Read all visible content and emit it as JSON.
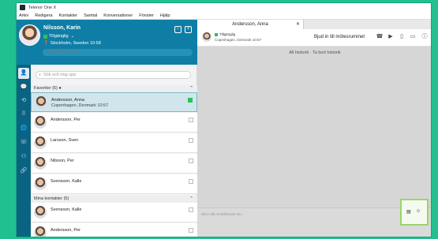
{
  "titlebar": {
    "title": "Telenor One X"
  },
  "menu": [
    "Arkiv",
    "Redigera",
    "Kontakter",
    "Samtal",
    "Konversationer",
    "Fönster",
    "Hjälp"
  ],
  "profile": {
    "name": "Nilsson, Karin",
    "status": "Tillgänglig",
    "location": "Stockholm, Sweden  10:58",
    "status_input_placeholder": "Vad händer idag?"
  },
  "search": {
    "placeholder": "Sök och ring upp"
  },
  "favorites": {
    "header": "Favoriter (5)",
    "items": [
      {
        "name": "Andersson, Anna",
        "location": "Copenhagen, Denmark 10:57",
        "status": "available",
        "selected": true
      },
      {
        "name": "Andersson, Per",
        "location": "",
        "status": "offline",
        "selected": false
      },
      {
        "name": "Larsson, Sven",
        "location": "",
        "status": "offline",
        "selected": false
      },
      {
        "name": "Nilsson, Per",
        "location": "",
        "status": "offline",
        "selected": false
      },
      {
        "name": "Svensson, Kalle",
        "location": "",
        "status": "offline",
        "selected": false
      }
    ]
  },
  "my_contacts": {
    "header": "Mina kontakter (5)",
    "items": [
      {
        "name": "Svensson, Kalle"
      },
      {
        "name": "Andersson, Per"
      }
    ]
  },
  "conversation": {
    "tab_label": "Andersson, Anna",
    "contact_status": "Tillgänglig",
    "contact_location": "Copenhagen, Denmark 10:57",
    "invite_label": "Bjud in till mötesrummet",
    "history_label": "All historik  ·  Ta bort historik",
    "compose_placeholder": "Skriv ditt meddelande här..."
  },
  "colors": {
    "profile_bg": "#0f7ea6",
    "rail_bg": "#0b6384",
    "available": "#2cc25a",
    "highlight": "#9bd46a"
  }
}
